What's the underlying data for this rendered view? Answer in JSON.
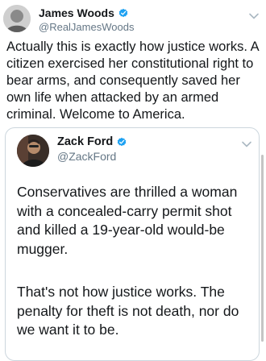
{
  "tweet": {
    "author_name": "James Woods",
    "author_handle": "@RealJamesWoods",
    "text": "Actually this is exactly how justice works. A citizen exercised her constitutional right to bear arms, and consequently saved her own life when attacked by an armed criminal. Welcome to America.",
    "quoted": {
      "author_name": "Zack Ford",
      "author_handle": "@ZackFord",
      "paragraph_1": "Conservatives are thrilled a woman with a concealed-carry permit shot and killed a 19-year-old would-be mugger.",
      "paragraph_2": "That's not how justice works. The penalty for theft is not death, nor do we want it to be."
    }
  },
  "icons": {
    "verified": "verified-badge-icon",
    "menu": "chevron-down-icon"
  },
  "colors": {
    "verified": "#1da1f2",
    "handle": "#657786",
    "border": "#ccd6dd"
  }
}
